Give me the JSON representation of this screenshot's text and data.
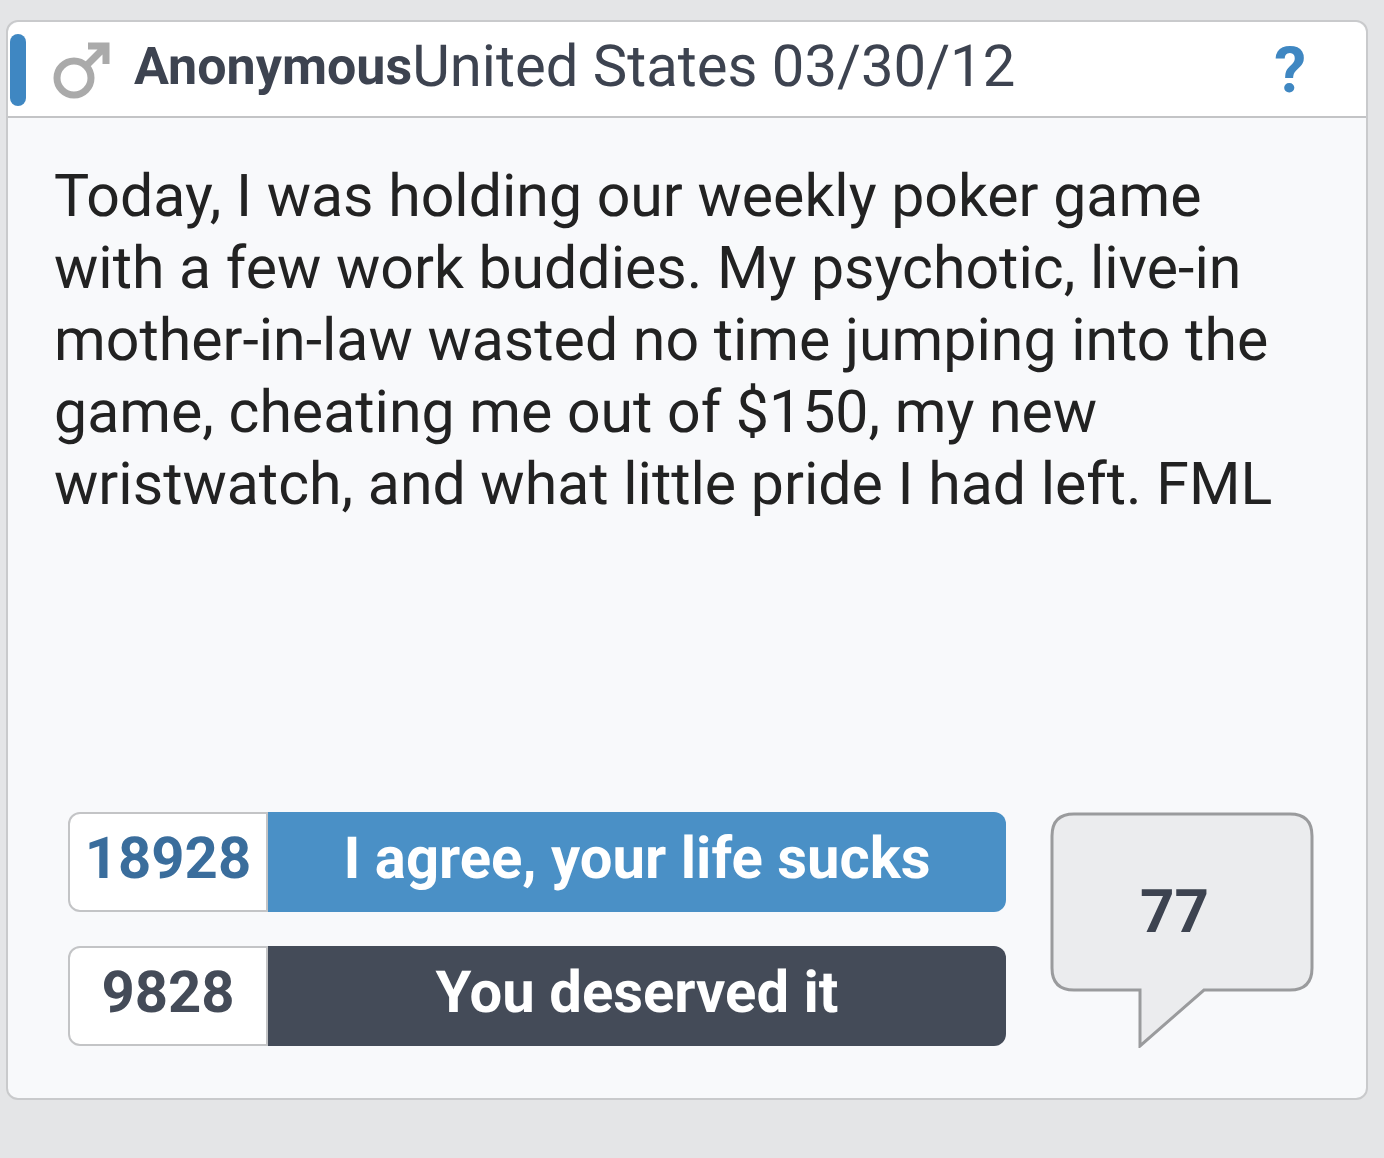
{
  "header": {
    "author": "Anonymous",
    "location": "United States",
    "date": "03/30/12",
    "help": "?"
  },
  "story": "Today, I was holding our weekly poker game with a few work buddies. My psychotic, live-in mother-in-law wasted no time jumping into the game, cheating me out of $150, my new wristwatch, and what little pride I had left. FML",
  "votes": [
    {
      "kind": "agree",
      "count": "18928",
      "label": "I agree, your life sucks"
    },
    {
      "kind": "deserved",
      "count": "9828",
      "label": "You deserved it"
    }
  ],
  "comments": {
    "count": "77"
  }
}
